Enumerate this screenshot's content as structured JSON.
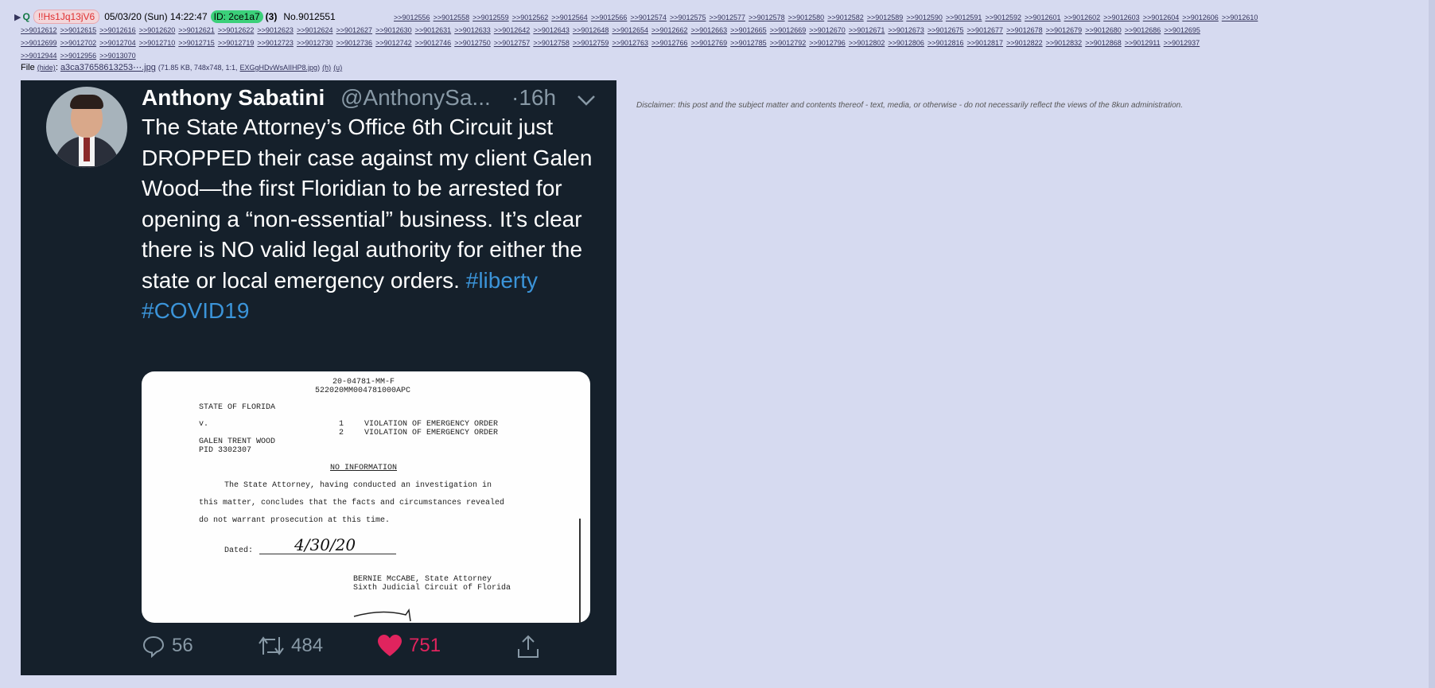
{
  "header": {
    "name": "Q",
    "trip": "!!Hs1Jq13jV6",
    "date": "05/03/20 (Sun) 14:22:47",
    "poster_id": "ID: 2ce1a7",
    "reply_count": "(3)",
    "post_no": "No.9012551"
  },
  "backlinks_first_line": [
    ">>9012556",
    ">>9012558",
    ">>9012559",
    ">>9012562",
    ">>9012564",
    ">>9012566",
    ">>9012574",
    ">>9012575",
    ">>9012577",
    ">>9012578",
    ">>9012580",
    ">>9012582",
    ">>9012589",
    ">>9012590",
    ">>9012591",
    ">>9012592",
    ">>9012601",
    ">>9012602",
    ">>9012603",
    ">>9012604",
    ">>9012606",
    ">>9012610"
  ],
  "backlinks_line2": [
    ">>9012612",
    ">>9012615",
    ">>9012616",
    ">>9012620",
    ">>9012621",
    ">>9012622",
    ">>9012623",
    ">>9012624",
    ">>9012627",
    ">>9012630",
    ">>9012631",
    ">>9012633",
    ">>9012642",
    ">>9012643",
    ">>9012648",
    ">>9012654",
    ">>9012662",
    ">>9012663",
    ">>9012665",
    ">>9012669",
    ">>9012670",
    ">>9012671",
    ">>9012673",
    ">>9012675",
    ">>9012677",
    ">>9012678",
    ">>9012679",
    ">>9012680",
    ">>9012686",
    ">>9012695"
  ],
  "backlinks_line3": [
    ">>9012699",
    ">>9012702",
    ">>9012704",
    ">>9012710",
    ">>9012715",
    ">>9012719",
    ">>9012723",
    ">>9012730",
    ">>9012736",
    ">>9012742",
    ">>9012746",
    ">>9012750",
    ">>9012757",
    ">>9012758",
    ">>9012759",
    ">>9012763",
    ">>9012766",
    ">>9012769",
    ">>9012785",
    ">>9012792",
    ">>9012796",
    ">>9012802",
    ">>9012806",
    ">>9012816",
    ">>9012817",
    ">>9012822",
    ">>9012832",
    ">>9012868",
    ">>9012911",
    ">>9012937"
  ],
  "backlinks_line4": [
    ">>9012944",
    ">>9012956",
    ">>9013070"
  ],
  "file": {
    "label": "File",
    "hide": "(hide)",
    "filename": "a3ca37658613253⋯.jpg",
    "meta": "(71.85 KB, 748x748, 1:1,",
    "orig_name": "EXGgHDvWsAIIHP8.jpg",
    "meta_end": ")",
    "h": "(h)",
    "u": "(u)"
  },
  "tweet": {
    "name": "Anthony Sabatini",
    "handle": "@AnthonySa...",
    "time": "·16h",
    "text": "The State Attorney’s Office 6th Circuit just DROPPED their case against my client Galen Wood—the first Floridian to be arrested for opening a “non-essential” business.  It’s clear there is NO valid legal authority for either the state or local emergency orders. ",
    "hashtag1": "#liberty",
    "hashtag2": "#COVID19",
    "replies": "56",
    "retweets": "484",
    "likes": "751"
  },
  "document": {
    "case_no": "20-04781-MM-F",
    "case_id": "522020MM004781000APC",
    "state": "STATE OF FLORIDA",
    "v": "v.",
    "count1_num": "1",
    "count1": "VIOLATION OF EMERGENCY ORDER",
    "count2_num": "2",
    "count2": "VIOLATION OF EMERGENCY ORDER",
    "defendant": "GALEN TRENT WOOD",
    "pid": "PID 3302307",
    "heading": "NO INFORMATION",
    "body1": "The State Attorney, having conducted an investigation in",
    "body2": "this matter, concludes that the facts and circumstances revealed",
    "body3": "do not warrant prosecution at this time.",
    "dated_label": "Dated:",
    "dated_value": "4/30/20",
    "signer1": "BERNIE McCABE, State Attorney",
    "signer2": "Sixth Judicial Circuit of Florida"
  },
  "disclaimer": "Disclaimer: this post and the subject matter and contents thereof - text, media, or otherwise - do not necessarily reflect the views of the 8kun administration."
}
